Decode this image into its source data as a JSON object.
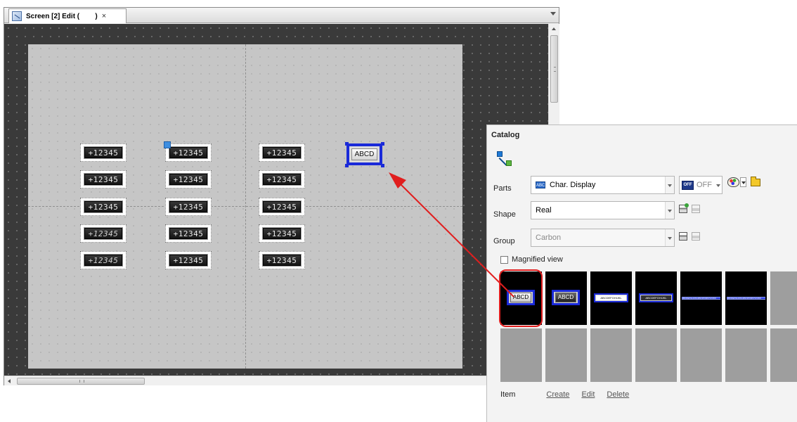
{
  "editor": {
    "tab_label": "Screen [2] Edit (        )",
    "tab_close": "×",
    "number_displays": [
      {
        "text": "+12345"
      },
      {
        "text": "+12345"
      },
      {
        "text": "+12345"
      },
      {
        "text": "+12345"
      },
      {
        "text": "+12345"
      },
      {
        "text": "+12345"
      },
      {
        "text": "+12345"
      },
      {
        "text": "+12345"
      },
      {
        "text": "+12345"
      },
      {
        "text": "+12345"
      },
      {
        "text": "+12345"
      },
      {
        "text": "+12345"
      },
      {
        "text": "+12345"
      },
      {
        "text": "+12345"
      },
      {
        "text": "+12345"
      }
    ],
    "char_display_text": "ABCD",
    "hscroll_grip": "III"
  },
  "catalog": {
    "title": "Catalog",
    "parts_label": "Parts",
    "parts_value": "Char. Display",
    "parts_icon_text": "ABC",
    "off_icon_text": "OFF",
    "off_text": "OFF",
    "shape_label": "Shape",
    "shape_value": "Real",
    "group_label": "Group",
    "group_value": "Carbon",
    "magnified_label": "Magnified view",
    "tiles_row1": [
      {
        "text": "ABCD"
      },
      {
        "text": "ABCD"
      },
      {
        "text": "ABCDEFGHIJKL"
      },
      {
        "text": "ABCDEFGHIJKL"
      },
      {
        "text": "ABCDEFGHIJKLMNOPQRSTUVWX"
      },
      {
        "text": "ABCDEFGHIJKLMNOPQRSTUVWX"
      }
    ],
    "footer": {
      "item_label": "Item",
      "create": "Create",
      "edit": "Edit",
      "delete": "Delete"
    }
  },
  "colors": {
    "selection_blue": "#1a2ad9",
    "arrow_red": "#e01e1e",
    "canvas_dark": "#3a3a3a",
    "screen_gray": "#c6c6c6"
  }
}
